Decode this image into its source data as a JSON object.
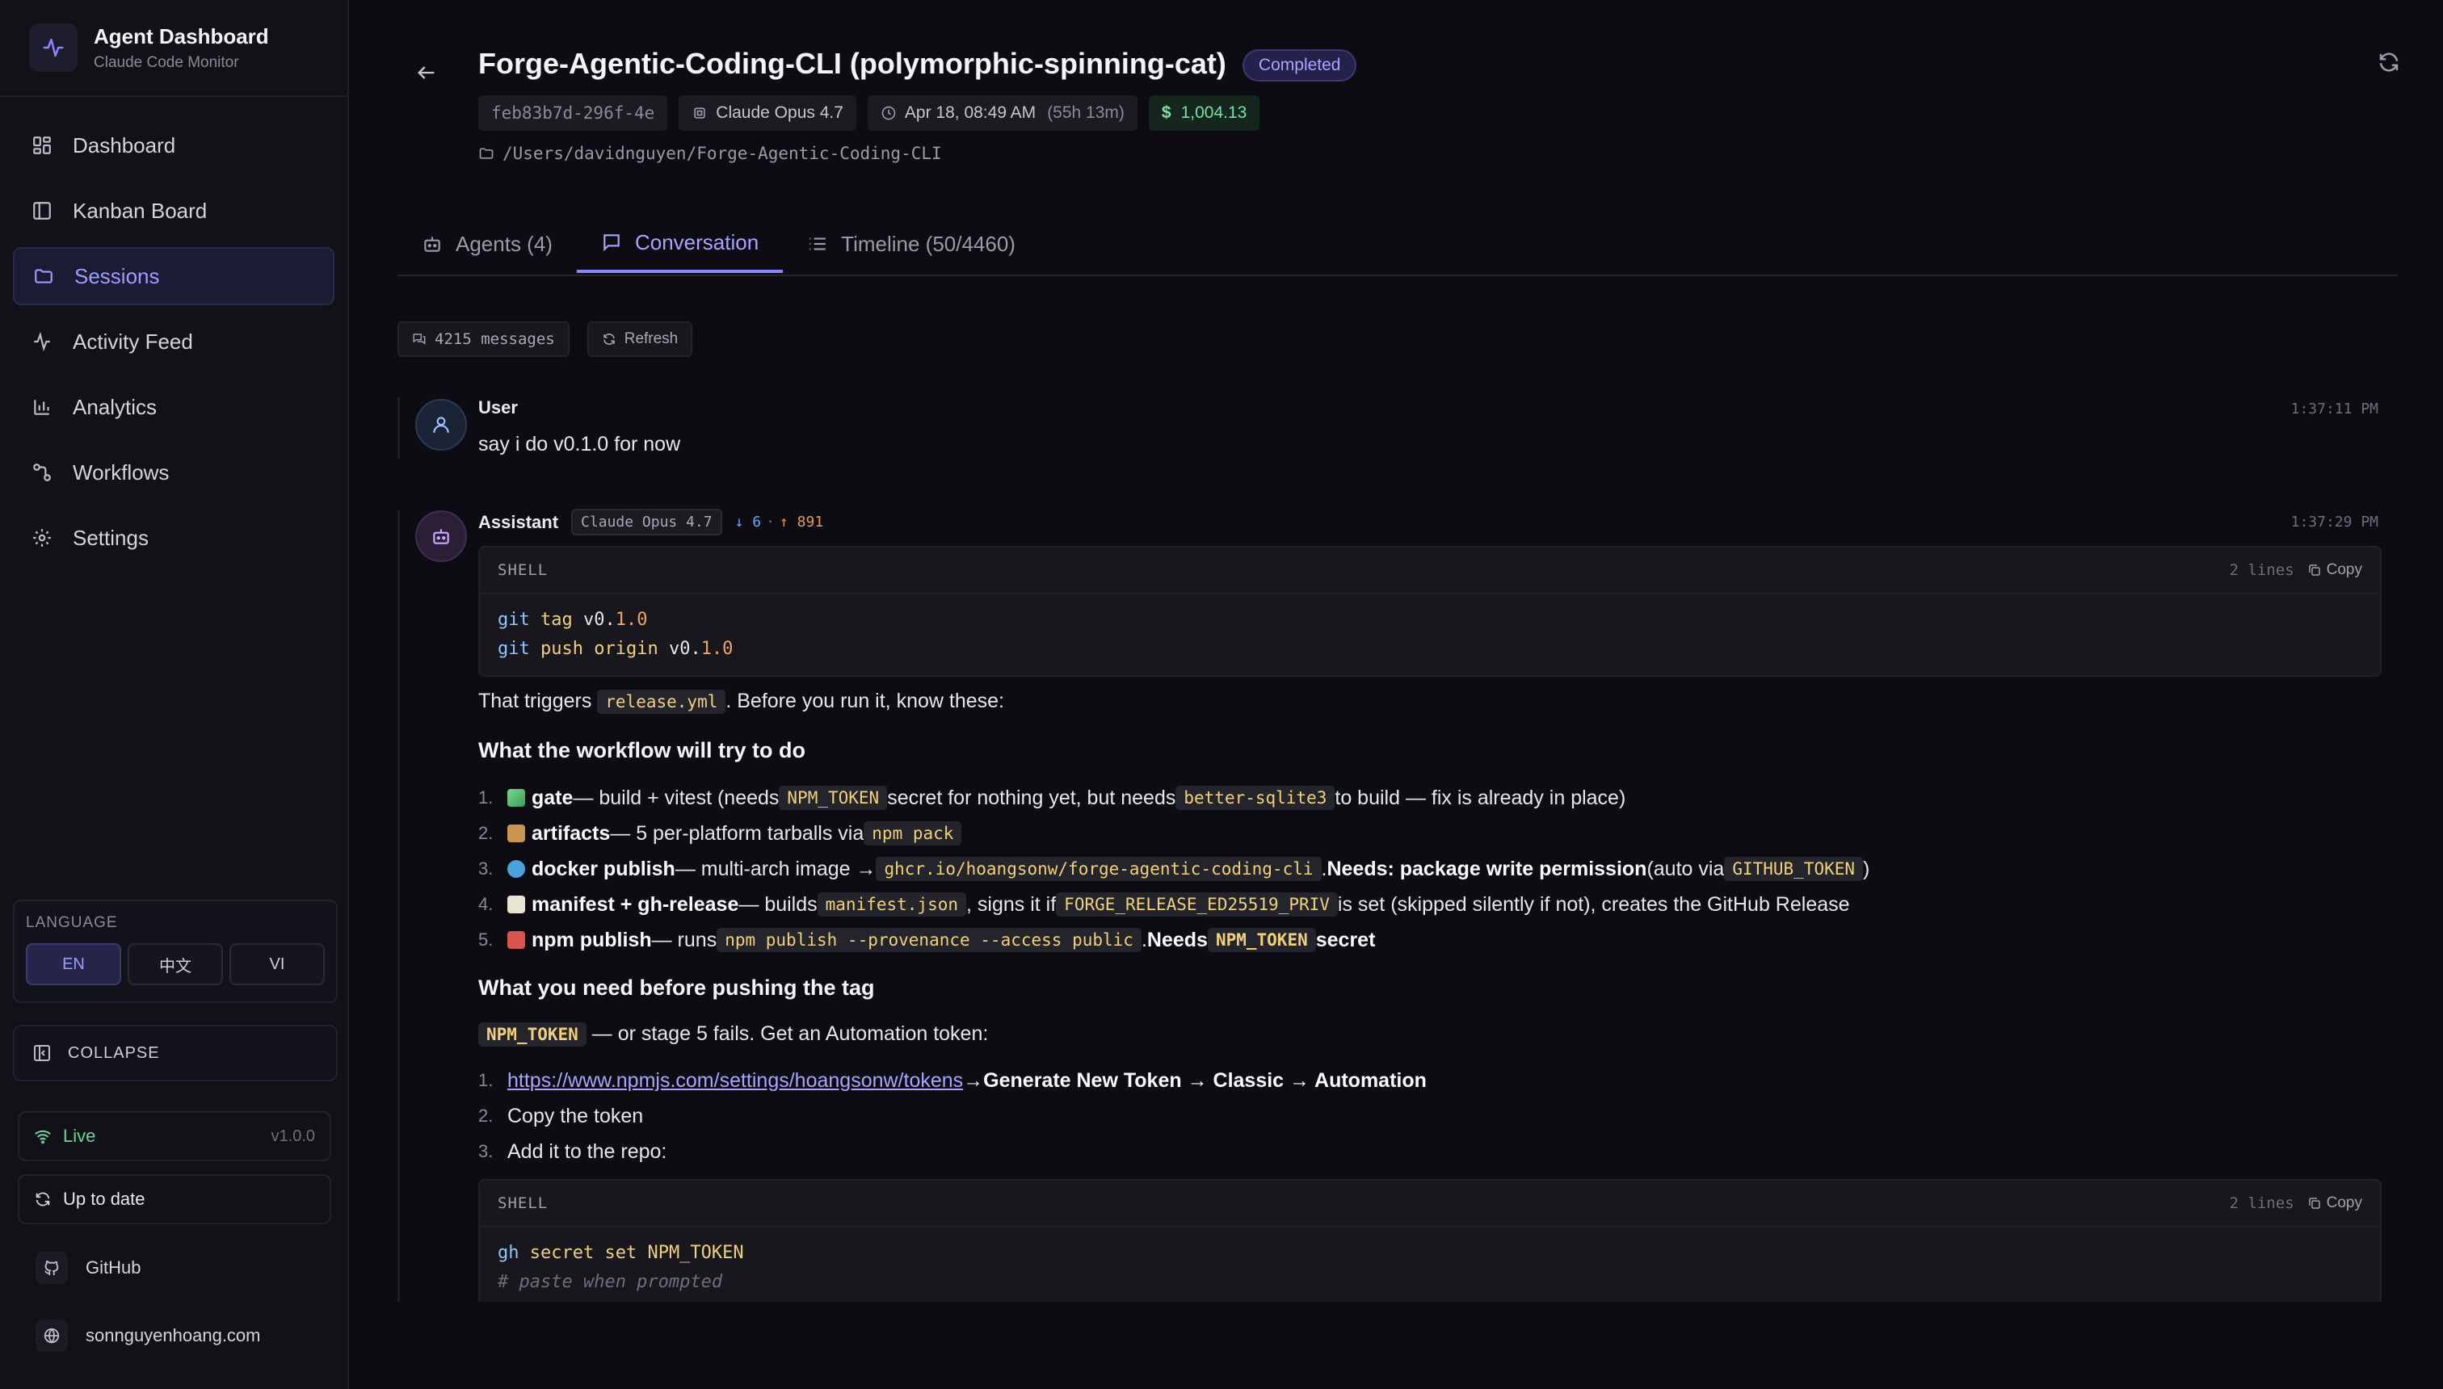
{
  "brand": {
    "title": "Agent Dashboard",
    "subtitle": "Claude Code Monitor"
  },
  "nav": {
    "items": [
      {
        "label": "Dashboard",
        "icon": "grid-icon"
      },
      {
        "label": "Kanban Board",
        "icon": "columns-icon"
      },
      {
        "label": "Sessions",
        "icon": "folder-icon",
        "active": true
      },
      {
        "label": "Activity Feed",
        "icon": "activity-icon"
      },
      {
        "label": "Analytics",
        "icon": "bar-chart-icon"
      },
      {
        "label": "Workflows",
        "icon": "workflow-icon"
      },
      {
        "label": "Settings",
        "icon": "gear-icon"
      }
    ]
  },
  "language": {
    "label": "LANGUAGE",
    "options": [
      "EN",
      "中文",
      "VI"
    ],
    "selected": "EN"
  },
  "collapse_label": "COLLAPSE",
  "status": {
    "live": "Live",
    "version": "v1.0.0",
    "update": "Up to date"
  },
  "footer": {
    "github": "GitHub",
    "website": "sonnguyenhoang.com"
  },
  "session": {
    "title": "Forge-Agentic-Coding-CLI (polymorphic-spinning-cat)",
    "status": "Completed",
    "id": "feb83b7d-296f-4e",
    "model": "Claude Opus 4.7",
    "started": "Apr 18, 08:49 AM",
    "duration": "(55h 13m)",
    "cost": "1,004.13",
    "cost_symbol": "$",
    "path": "/Users/davidnguyen/Forge-Agentic-Coding-CLI"
  },
  "tabs": [
    {
      "label": "Agents (4)"
    },
    {
      "label": "Conversation",
      "active": true
    },
    {
      "label": "Timeline (50/4460)"
    }
  ],
  "toolbar": {
    "messages": "4215 messages",
    "refresh": "Refresh"
  },
  "messages": {
    "user": {
      "role": "User",
      "time": "1:37:11 PM",
      "text": "say i do v0.1.0 for now"
    },
    "assistant": {
      "role": "Assistant",
      "model": "Claude Opus 4.7",
      "tokens_in": "↓ 6",
      "tokens_sep": "·",
      "tokens_out": "↑ 891",
      "time": "1:37:29 PM",
      "code1": {
        "lang": "SHELL",
        "lines": "2 lines",
        "copy": "Copy"
      },
      "p1_a": "That triggers ",
      "p1_code": "release.yml",
      "p1_b": ". Before you run it, know these:",
      "h1": "What the workflow will try to do",
      "list1": {
        "i1": {
          "n": "1.",
          "name": "gate",
          "t1": " — build + vitest (needs ",
          "c1": "NPM_TOKEN",
          "t2": " secret for nothing yet, but needs ",
          "c2": "better-sqlite3",
          "t3": " to build — fix is already in place)"
        },
        "i2": {
          "n": "2.",
          "name": "artifacts",
          "t1": " — 5 per-platform tarballs via ",
          "c1": "npm pack"
        },
        "i3": {
          "n": "3.",
          "name": "docker publish",
          "t1": " — multi-arch image → ",
          "c1": "ghcr.io/hoangsonw/forge-agentic-coding-cli",
          "t2": ". ",
          "b1": "Needs: package write permission",
          "t3": " (auto via ",
          "c2": "GITHUB_TOKEN",
          "t4": ")"
        },
        "i4": {
          "n": "4.",
          "name": "manifest + gh-release",
          "t1": " — builds ",
          "c1": "manifest.json",
          "t2": ", signs it if ",
          "c2": "FORGE_RELEASE_ED25519_PRIV",
          "t3": " is set (skipped silently if not), creates the GitHub Release"
        },
        "i5": {
          "n": "5.",
          "name": "npm publish",
          "t1": " — runs ",
          "c1": "npm publish --provenance --access public",
          "t2": ". ",
          "b1": "Needs ",
          "c2": "NPM_TOKEN",
          "b2": " secret"
        }
      },
      "h2": "What you need before pushing the tag",
      "p2_code": "NPM_TOKEN",
      "p2_text": " — or stage 5 fails. Get an Automation token:",
      "list2": {
        "i1": {
          "n": "1.",
          "link": "https://www.npmjs.com/settings/hoangsonw/tokens",
          "t1": " → ",
          "b1": "Generate New Token → Classic → Automation"
        },
        "i2": {
          "n": "2.",
          "t1": "Copy the token"
        },
        "i3": {
          "n": "3.",
          "t1": "Add it to the repo:"
        }
      },
      "code2": {
        "lang": "SHELL",
        "lines": "2 lines",
        "copy": "Copy"
      }
    }
  },
  "code1_lines": {
    "l1": {
      "cmd": "git",
      "kw": "tag",
      "a": " v0.",
      "n": "1.0"
    },
    "l2": {
      "cmd": "git",
      "kw": "push origin",
      "a": " v0.",
      "n": "1.0"
    }
  },
  "code2_lines": {
    "l1": {
      "cmd": "gh",
      "kw": "secret set",
      "a": " NPM_TOKEN"
    },
    "l2": {
      "comment": "# paste when prompted"
    }
  },
  "colors": {
    "accent": "#8a86ff",
    "cost": "#7be0a3",
    "code_text": "#f0d07a",
    "bg": "#0c0c12"
  }
}
